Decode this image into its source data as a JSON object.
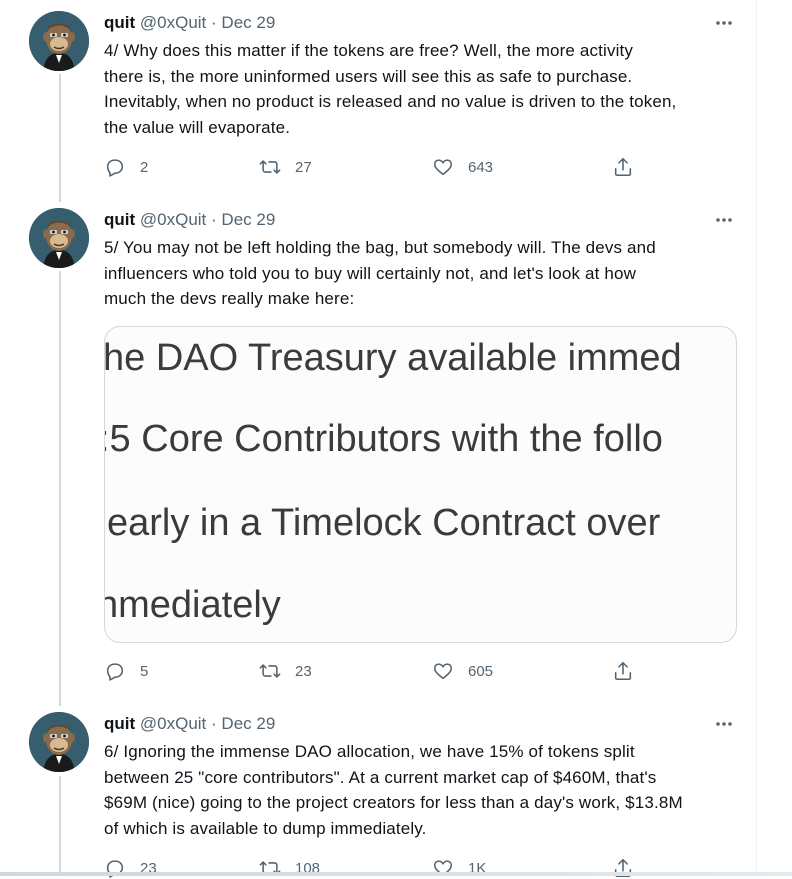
{
  "tweets": [
    {
      "name": "quit",
      "handle": "@0xQuit",
      "separator": "·",
      "date": "Dec 29",
      "lines": [
        "4/ Why does this matter if the tokens are free?  Well, the more activity",
        "there is, the more uninformed users will see this as safe to purchase.",
        "Inevitably, when no product is released and no value is driven to the token,",
        "the value will evaporate."
      ],
      "replies": "2",
      "retweets": "27",
      "likes": "643"
    },
    {
      "name": "quit",
      "handle": "@0xQuit",
      "separator": "·",
      "date": "Dec 29",
      "lines": [
        "5/ You may not be left holding the bag, but somebody will.  The devs and",
        "influencers who told you to buy will certainly not, and let's look at how",
        "much the devs really make here:"
      ],
      "media_lines": [
        "he DAO Treasury available immed",
        ":5 Core Contributors with the follo",
        "early in a Timelock Contract over",
        "nmediately"
      ],
      "replies": "5",
      "retweets": "23",
      "likes": "605"
    },
    {
      "name": "quit",
      "handle": "@0xQuit",
      "separator": "·",
      "date": "Dec 29",
      "lines": [
        "6/ Ignoring the immense DAO allocation, we have 15% of tokens split",
        "between 25 \"core contributors\".  At a current market cap of $460M, that's",
        "$69M (nice) going to the project creators for less than a day's work, $13.8M",
        "of which is available to dump immediately."
      ],
      "replies": "23",
      "retweets": "108",
      "likes": "1K"
    }
  ],
  "icons": {
    "more": "more-horizontal-icon",
    "reply": "reply-bubble-icon",
    "retweet": "retweet-arrows-icon",
    "like": "heart-icon",
    "share": "share-upload-icon",
    "avatar": "ape-avatar"
  },
  "colors": {
    "text": "#0f1419",
    "secondary": "#536471",
    "thread_line": "#cfd9de",
    "card_border": "#cfd9de"
  }
}
